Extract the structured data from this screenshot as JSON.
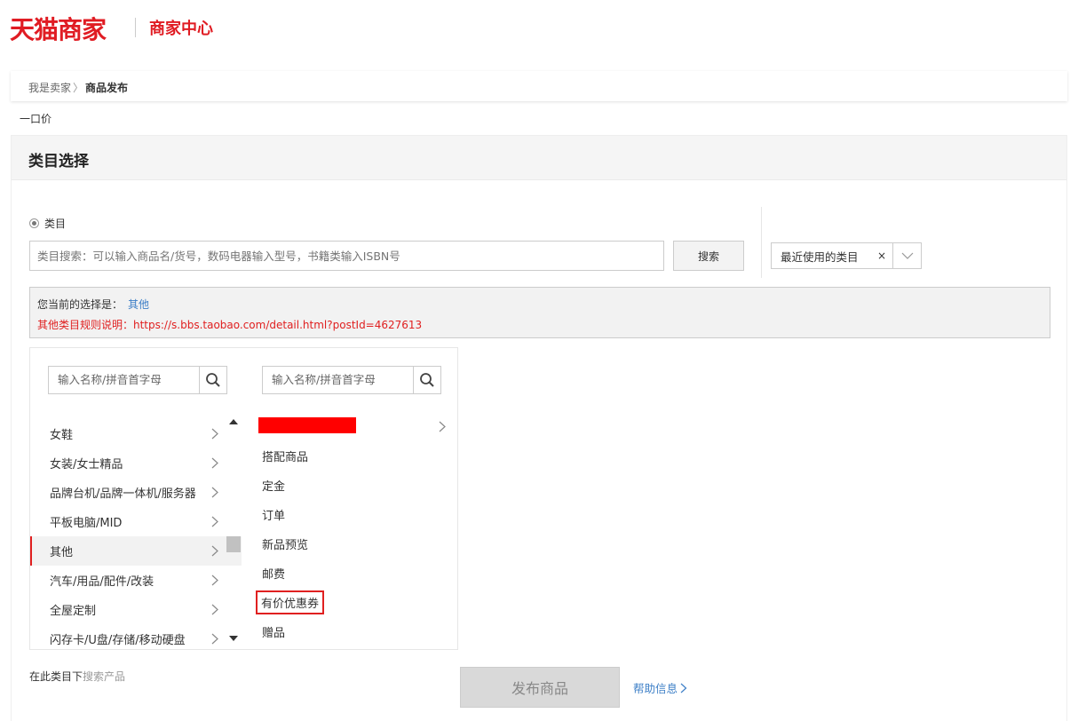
{
  "header": {
    "brand": "天猫商家",
    "subtitle": "商家中心"
  },
  "breadcrumb": {
    "parent": "我是卖家",
    "current": "商品发布"
  },
  "price_type": "一口价",
  "panel": {
    "title": "类目选择"
  },
  "category_radio_label": "类目",
  "search": {
    "placeholder": "类目搜索：可以输入商品名/货号，数码电器输入型号，书籍类输入ISBN号",
    "button": "搜索"
  },
  "recent": {
    "label": "最近使用的类目",
    "clear": "×"
  },
  "selection": {
    "prefix": "您当前的选择是：",
    "value": "其他",
    "rule": "其他类目规则说明：https://s.bbs.taobao.com/detail.html?postId=4627613"
  },
  "column_search_placeholder": "输入名称/拼音首字母",
  "level1": [
    {
      "label": "女鞋"
    },
    {
      "label": "女装/女士精品"
    },
    {
      "label": "品牌台机/品牌一体机/服务器"
    },
    {
      "label": "平板电脑/MID"
    },
    {
      "label": "其他"
    },
    {
      "label": "汽车/用品/配件/改装"
    },
    {
      "label": "全屋定制"
    },
    {
      "label": "闪存卡/U盘/存储/移动硬盘"
    }
  ],
  "level2": [
    {
      "label": "搭配商品"
    },
    {
      "label": "定金"
    },
    {
      "label": "订单"
    },
    {
      "label": "新品预览"
    },
    {
      "label": "邮费"
    },
    {
      "label": "有价优惠券"
    },
    {
      "label": "赠品"
    }
  ],
  "footer": {
    "search_prefix": "在此类目下",
    "search_link": "搜索产品",
    "publish": "发布商品",
    "help": "帮助信息"
  }
}
